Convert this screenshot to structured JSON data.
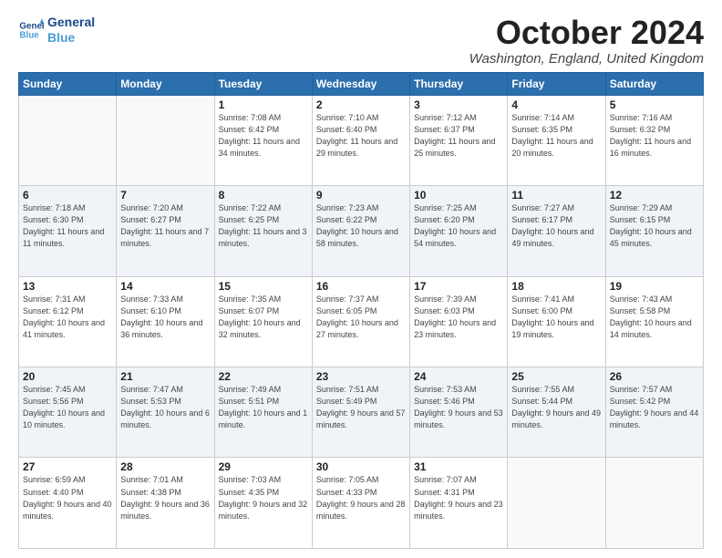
{
  "logo": {
    "line1": "General",
    "line2": "Blue"
  },
  "header": {
    "month": "October 2024",
    "location": "Washington, England, United Kingdom"
  },
  "weekdays": [
    "Sunday",
    "Monday",
    "Tuesday",
    "Wednesday",
    "Thursday",
    "Friday",
    "Saturday"
  ],
  "rows": [
    [
      {
        "day": "",
        "sunrise": "",
        "sunset": "",
        "daylight": ""
      },
      {
        "day": "",
        "sunrise": "",
        "sunset": "",
        "daylight": ""
      },
      {
        "day": "1",
        "sunrise": "Sunrise: 7:08 AM",
        "sunset": "Sunset: 6:42 PM",
        "daylight": "Daylight: 11 hours and 34 minutes."
      },
      {
        "day": "2",
        "sunrise": "Sunrise: 7:10 AM",
        "sunset": "Sunset: 6:40 PM",
        "daylight": "Daylight: 11 hours and 29 minutes."
      },
      {
        "day": "3",
        "sunrise": "Sunrise: 7:12 AM",
        "sunset": "Sunset: 6:37 PM",
        "daylight": "Daylight: 11 hours and 25 minutes."
      },
      {
        "day": "4",
        "sunrise": "Sunrise: 7:14 AM",
        "sunset": "Sunset: 6:35 PM",
        "daylight": "Daylight: 11 hours and 20 minutes."
      },
      {
        "day": "5",
        "sunrise": "Sunrise: 7:16 AM",
        "sunset": "Sunset: 6:32 PM",
        "daylight": "Daylight: 11 hours and 16 minutes."
      }
    ],
    [
      {
        "day": "6",
        "sunrise": "Sunrise: 7:18 AM",
        "sunset": "Sunset: 6:30 PM",
        "daylight": "Daylight: 11 hours and 11 minutes."
      },
      {
        "day": "7",
        "sunrise": "Sunrise: 7:20 AM",
        "sunset": "Sunset: 6:27 PM",
        "daylight": "Daylight: 11 hours and 7 minutes."
      },
      {
        "day": "8",
        "sunrise": "Sunrise: 7:22 AM",
        "sunset": "Sunset: 6:25 PM",
        "daylight": "Daylight: 11 hours and 3 minutes."
      },
      {
        "day": "9",
        "sunrise": "Sunrise: 7:23 AM",
        "sunset": "Sunset: 6:22 PM",
        "daylight": "Daylight: 10 hours and 58 minutes."
      },
      {
        "day": "10",
        "sunrise": "Sunrise: 7:25 AM",
        "sunset": "Sunset: 6:20 PM",
        "daylight": "Daylight: 10 hours and 54 minutes."
      },
      {
        "day": "11",
        "sunrise": "Sunrise: 7:27 AM",
        "sunset": "Sunset: 6:17 PM",
        "daylight": "Daylight: 10 hours and 49 minutes."
      },
      {
        "day": "12",
        "sunrise": "Sunrise: 7:29 AM",
        "sunset": "Sunset: 6:15 PM",
        "daylight": "Daylight: 10 hours and 45 minutes."
      }
    ],
    [
      {
        "day": "13",
        "sunrise": "Sunrise: 7:31 AM",
        "sunset": "Sunset: 6:12 PM",
        "daylight": "Daylight: 10 hours and 41 minutes."
      },
      {
        "day": "14",
        "sunrise": "Sunrise: 7:33 AM",
        "sunset": "Sunset: 6:10 PM",
        "daylight": "Daylight: 10 hours and 36 minutes."
      },
      {
        "day": "15",
        "sunrise": "Sunrise: 7:35 AM",
        "sunset": "Sunset: 6:07 PM",
        "daylight": "Daylight: 10 hours and 32 minutes."
      },
      {
        "day": "16",
        "sunrise": "Sunrise: 7:37 AM",
        "sunset": "Sunset: 6:05 PM",
        "daylight": "Daylight: 10 hours and 27 minutes."
      },
      {
        "day": "17",
        "sunrise": "Sunrise: 7:39 AM",
        "sunset": "Sunset: 6:03 PM",
        "daylight": "Daylight: 10 hours and 23 minutes."
      },
      {
        "day": "18",
        "sunrise": "Sunrise: 7:41 AM",
        "sunset": "Sunset: 6:00 PM",
        "daylight": "Daylight: 10 hours and 19 minutes."
      },
      {
        "day": "19",
        "sunrise": "Sunrise: 7:43 AM",
        "sunset": "Sunset: 5:58 PM",
        "daylight": "Daylight: 10 hours and 14 minutes."
      }
    ],
    [
      {
        "day": "20",
        "sunrise": "Sunrise: 7:45 AM",
        "sunset": "Sunset: 5:56 PM",
        "daylight": "Daylight: 10 hours and 10 minutes."
      },
      {
        "day": "21",
        "sunrise": "Sunrise: 7:47 AM",
        "sunset": "Sunset: 5:53 PM",
        "daylight": "Daylight: 10 hours and 6 minutes."
      },
      {
        "day": "22",
        "sunrise": "Sunrise: 7:49 AM",
        "sunset": "Sunset: 5:51 PM",
        "daylight": "Daylight: 10 hours and 1 minute."
      },
      {
        "day": "23",
        "sunrise": "Sunrise: 7:51 AM",
        "sunset": "Sunset: 5:49 PM",
        "daylight": "Daylight: 9 hours and 57 minutes."
      },
      {
        "day": "24",
        "sunrise": "Sunrise: 7:53 AM",
        "sunset": "Sunset: 5:46 PM",
        "daylight": "Daylight: 9 hours and 53 minutes."
      },
      {
        "day": "25",
        "sunrise": "Sunrise: 7:55 AM",
        "sunset": "Sunset: 5:44 PM",
        "daylight": "Daylight: 9 hours and 49 minutes."
      },
      {
        "day": "26",
        "sunrise": "Sunrise: 7:57 AM",
        "sunset": "Sunset: 5:42 PM",
        "daylight": "Daylight: 9 hours and 44 minutes."
      }
    ],
    [
      {
        "day": "27",
        "sunrise": "Sunrise: 6:59 AM",
        "sunset": "Sunset: 4:40 PM",
        "daylight": "Daylight: 9 hours and 40 minutes."
      },
      {
        "day": "28",
        "sunrise": "Sunrise: 7:01 AM",
        "sunset": "Sunset: 4:38 PM",
        "daylight": "Daylight: 9 hours and 36 minutes."
      },
      {
        "day": "29",
        "sunrise": "Sunrise: 7:03 AM",
        "sunset": "Sunset: 4:35 PM",
        "daylight": "Daylight: 9 hours and 32 minutes."
      },
      {
        "day": "30",
        "sunrise": "Sunrise: 7:05 AM",
        "sunset": "Sunset: 4:33 PM",
        "daylight": "Daylight: 9 hours and 28 minutes."
      },
      {
        "day": "31",
        "sunrise": "Sunrise: 7:07 AM",
        "sunset": "Sunset: 4:31 PM",
        "daylight": "Daylight: 9 hours and 23 minutes."
      },
      {
        "day": "",
        "sunrise": "",
        "sunset": "",
        "daylight": ""
      },
      {
        "day": "",
        "sunrise": "",
        "sunset": "",
        "daylight": ""
      }
    ]
  ]
}
